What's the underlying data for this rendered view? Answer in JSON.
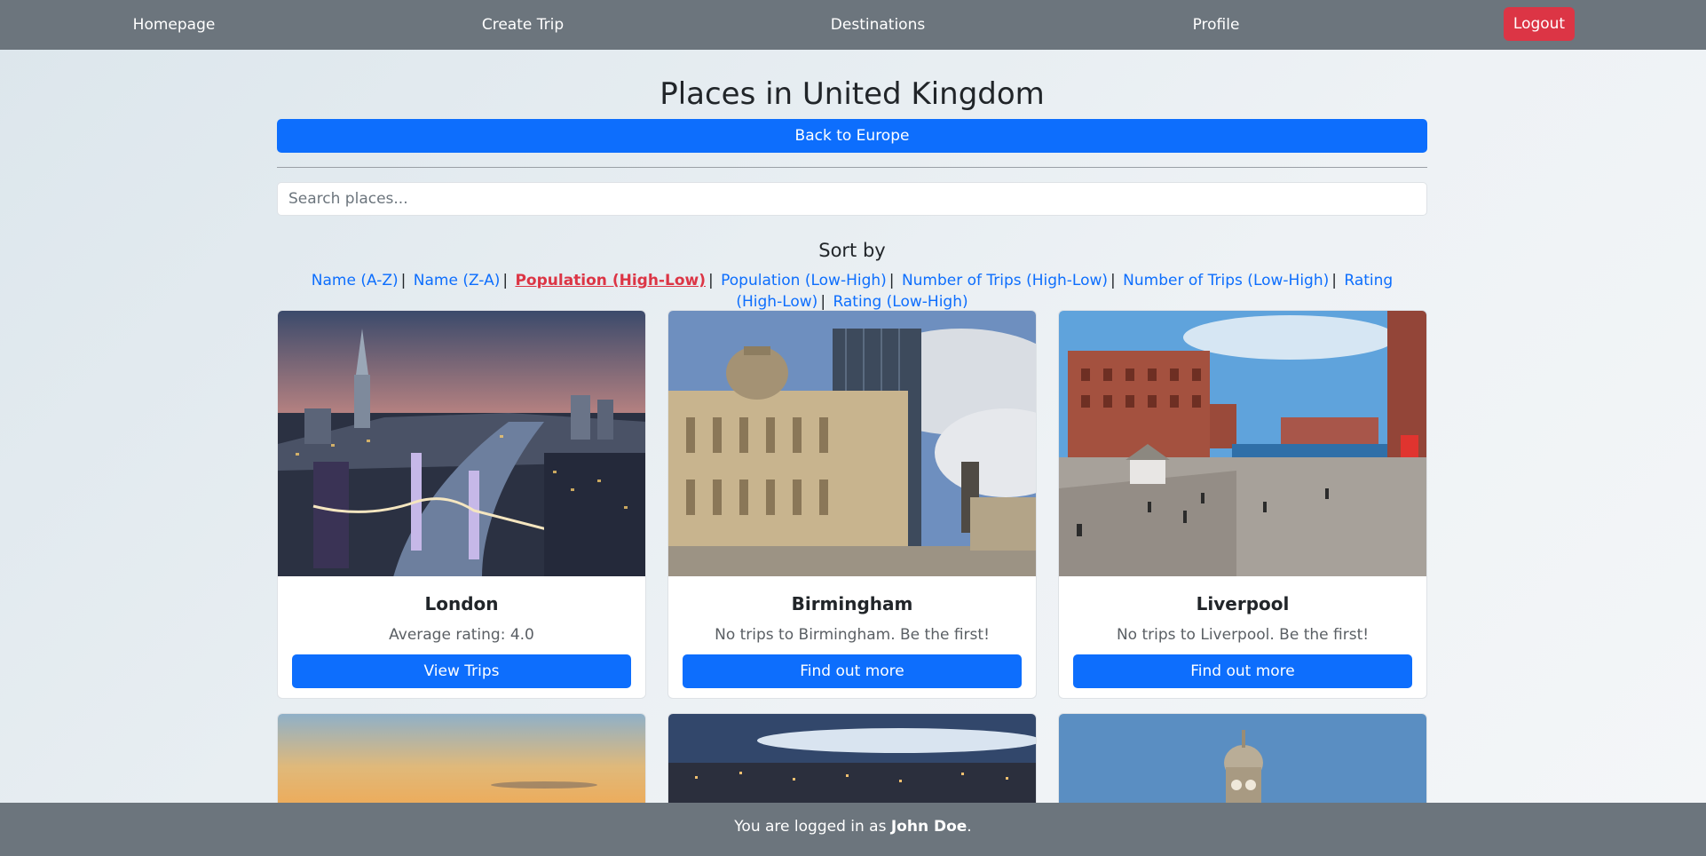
{
  "nav": {
    "items": [
      {
        "label": "Homepage"
      },
      {
        "label": "Create Trip"
      },
      {
        "label": "Destinations"
      },
      {
        "label": "Profile"
      }
    ],
    "logout_label": "Logout"
  },
  "page": {
    "title": "Places in United Kingdom",
    "back_label": "Back to Europe",
    "search_placeholder": "Search places...",
    "sort_heading": "Sort by"
  },
  "sort_options": [
    {
      "label": "Name (A-Z)",
      "active": false
    },
    {
      "label": "Name (Z-A)",
      "active": false
    },
    {
      "label": "Population (High-Low)",
      "active": true
    },
    {
      "label": "Population (Low-High)",
      "active": false
    },
    {
      "label": "Number of Trips (High-Low)",
      "active": false
    },
    {
      "label": "Number of Trips (Low-High)",
      "active": false
    },
    {
      "label": "Rating (High-Low)",
      "active": false
    },
    {
      "label": "Rating (Low-High)",
      "active": false
    }
  ],
  "places": [
    {
      "name": "London",
      "text": "Average rating: 4.0",
      "button": "View Trips"
    },
    {
      "name": "Birmingham",
      "text": "No trips to Birmingham. Be the first!",
      "button": "Find out more"
    },
    {
      "name": "Liverpool",
      "text": "No trips to Liverpool. Be the first!",
      "button": "Find out more"
    }
  ],
  "footer": {
    "prefix": "You are logged in as ",
    "user": "John Doe",
    "suffix": "."
  },
  "colors": {
    "navbar": "#6c757d",
    "primary": "#0d6efd",
    "danger": "#dc3545"
  }
}
